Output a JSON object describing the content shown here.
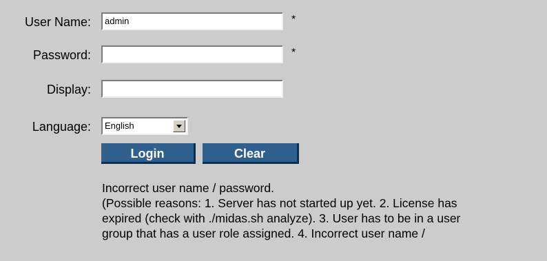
{
  "form": {
    "username": {
      "label": "User Name:",
      "value": "admin",
      "required_mark": "*"
    },
    "password": {
      "label": "Password:",
      "value": "",
      "required_mark": "*"
    },
    "display": {
      "label": "Display:",
      "value": ""
    },
    "language": {
      "label": "Language:",
      "selected": "English"
    },
    "login_label": "Login",
    "clear_label": "Clear"
  },
  "error": {
    "lines": [
      "Incorrect user name / password.",
      "(Possible reasons: 1. Server has not started up yet. 2. License has",
      "expired (check with ./midas.sh analyze). 3. User has to be in a user",
      "group that has a user role assigned. 4. Incorrect user name /"
    ]
  },
  "colors": {
    "background": "#cccccc",
    "button": "#2f5f8c",
    "button_shadow": "#0e2e4e"
  }
}
